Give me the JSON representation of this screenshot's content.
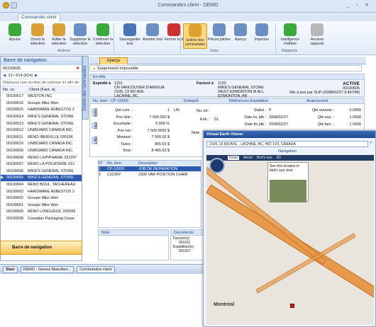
{
  "window": {
    "title": "Commandes client - DEMO",
    "controls": "_ ▫ ✕"
  },
  "ribbon_tab": "Commandes client",
  "ribbon": {
    "buttons": [
      {
        "label": "Ajouter",
        "color": "#3aa83a"
      },
      {
        "label": "Ouvrir la sélection",
        "color": "#d9a035"
      },
      {
        "label": "Éditer la sélection",
        "color": "#d9a035"
      },
      {
        "label": "Supprimer la sélection",
        "color": "#6a8fc4"
      },
      {
        "label": "Confirmer la sélection",
        "color": "#3aa83a"
      },
      {
        "label": "Sauvegarder tout",
        "color": "#4a74b8"
      },
      {
        "label": "Annuler tout",
        "color": "#6a8fc4"
      },
      {
        "label": "Fermer tout",
        "color": "#cc3030"
      },
      {
        "label": "Entrée des commandes",
        "color": "#e0a030"
      },
      {
        "label": "Pièces jointes",
        "color": "#6a8fc4"
      },
      {
        "label": "Aperçu",
        "color": "#6a8fc4"
      },
      {
        "label": "Imprimer",
        "color": "#6a8fc4"
      },
      {
        "label": "Intelligence d'affaire",
        "color": "#3aa83a"
      },
      {
        "label": "Anciens rapports",
        "color": "#b8b8b8"
      }
    ],
    "groups": [
      "Actions",
      "Vues",
      "Rapports"
    ]
  },
  "nav": {
    "title": "Barre de navigation",
    "search_value": "00100605",
    "page_info": "13 / 614 (614)",
    "hint": "Déplacez une en-tête de colonne ici afin de",
    "col_no": "No. co",
    "col_client": "Client (Fact. à)",
    "rows": [
      [
        "00100617",
        "WESTON INC"
      ],
      [
        "00100616",
        "Groupe Mike Weir"
      ],
      [
        "00100615",
        "HARDWARE ASBESTOS 2"
      ],
      [
        "00100614",
        "MIKE'S GENERAL STORE"
      ],
      [
        "00100613",
        "MIKE'S GENERAL STORE"
      ],
      [
        "00100612",
        "UNIBOARD CANADA INC."
      ],
      [
        "00100611",
        "RENO IBERVILLE 030106"
      ],
      [
        "00100610",
        "UNIBOARD CANADA INC."
      ],
      [
        "00100609",
        "UNIBOARD CANADA INC."
      ],
      [
        "00100608",
        "RENO L'EPIPHANIE 021337"
      ],
      [
        "00100607",
        "RENO LA POCATIERE 012"
      ],
      [
        "00100606",
        "MIKE'S GENERAL STORE"
      ],
      [
        "00100605",
        "MIKE'S GENERAL STORE"
      ],
      [
        "00100604",
        "RENO BOUL. TACHEREAU"
      ],
      [
        "00100603",
        "HARDWARE ASBESTOS 2"
      ],
      [
        "00100602",
        "Groupe Mike Weir"
      ],
      [
        "00100601",
        "Groupe Mike Weir"
      ],
      [
        "00100600",
        "RENO LONGUEUIL 205955"
      ],
      [
        "00100599",
        "Canadian Packaging Corpo"
      ]
    ],
    "selected_index": 12,
    "bottom_label": "Barre de navigation",
    "vertical_tab": "Entrée des commandes"
  },
  "taskbar": {
    "start": "Start",
    "item1": "DEMO - Genius Manufact...",
    "item2": "Commandes client"
  },
  "doc": {
    "tab": "Aperçu",
    "warning": "Suppression impossible",
    "entete_label": "En-tête",
    "expedie_label": "Expédié à",
    "expedie_lines": [
      "1101",
      "CN VANCOUVER D'AMIGUA",
      "2105, 23 RD AVE.",
      "LACHINE, BC"
    ],
    "facture_label": "Facturé à",
    "facture_lines": [
      "1133",
      "MIKE'S GENERAL STORE",
      "WEST EDMONTON M ALL",
      "EDMONTON, AB"
    ],
    "status": "ACTIVE",
    "order_no": "00100605",
    "updated": "Mis à jour par SUP (2008/02/27 3:49 PM)",
    "item_header": "No. item : CP-10000",
    "entrepot": "Entrepôt",
    "ref_exp": "Références Expédition",
    "avancement": "Avancement",
    "gen": "GÉN",
    "pri": "PRI",
    "det": "DÉT",
    "qte_com_lbl": "Qté com. :",
    "qte_com": "1",
    "unit": "UN",
    "prix_liste_lbl": "Prix liste :",
    "prix_liste": "7 500.000 $",
    "escompte_lbl": "Escompte :",
    "escompte": "0.000 %",
    "prix_net_lbl": "Prix net :",
    "prix_net": "7 500.0000 $",
    "montant_lbl": "Montant :",
    "montant": "7 500.00 $",
    "taxes_lbl": "Taxes :",
    "taxes": "965.63 $",
    "total_lbl": "Total :",
    "total": "8 465.63 $",
    "no_lot_lbl": "No. lot :",
    "entr_lbl": "Entr. :",
    "entr": "01",
    "statut_lbl": "Statut :",
    "statut": "P",
    "date_liv_lbl": "Date liv. jdb :",
    "date_liv": "2008/02/27",
    "date_fin_lbl": "Date fin jdb :",
    "date_fin": "2008/02/27",
    "qte_ouverte_lbl": "Qté ouverte :",
    "qte_ouverte": "0.0000",
    "qte_exp_lbl": "Qté exp. :",
    "qte_exp": "1.0000",
    "qte_fact_lbl": "Qté fact. :",
    "qte_fact": "1.0000",
    "note_label": "Note",
    "lines_header": [
      "N°",
      "No. item",
      "Description"
    ],
    "lines": [
      [
        "1",
        "CP-10000",
        "JOB DE REPARATION"
      ],
      [
        "2",
        "C2230Y",
        "2300 VAR POSITION CHAIR"
      ]
    ],
    "documents_label": "Documents",
    "docs_tree": [
      "Facture(s)",
      "001011",
      "Expédition(s)",
      "001007"
    ]
  },
  "popup": {
    "title": "Virtual Earth Viewer",
    "address": "2105, 23 RD AVE. , LACHINE, BC, H8T 1V3, CANADA",
    "nav_label": "Navigation",
    "map_tabs": [
      "Road",
      "Aerial",
      "Bird's eye",
      "3D"
    ],
    "birdseye_text": "See this location in bird's eye view",
    "city": "Montreal"
  }
}
